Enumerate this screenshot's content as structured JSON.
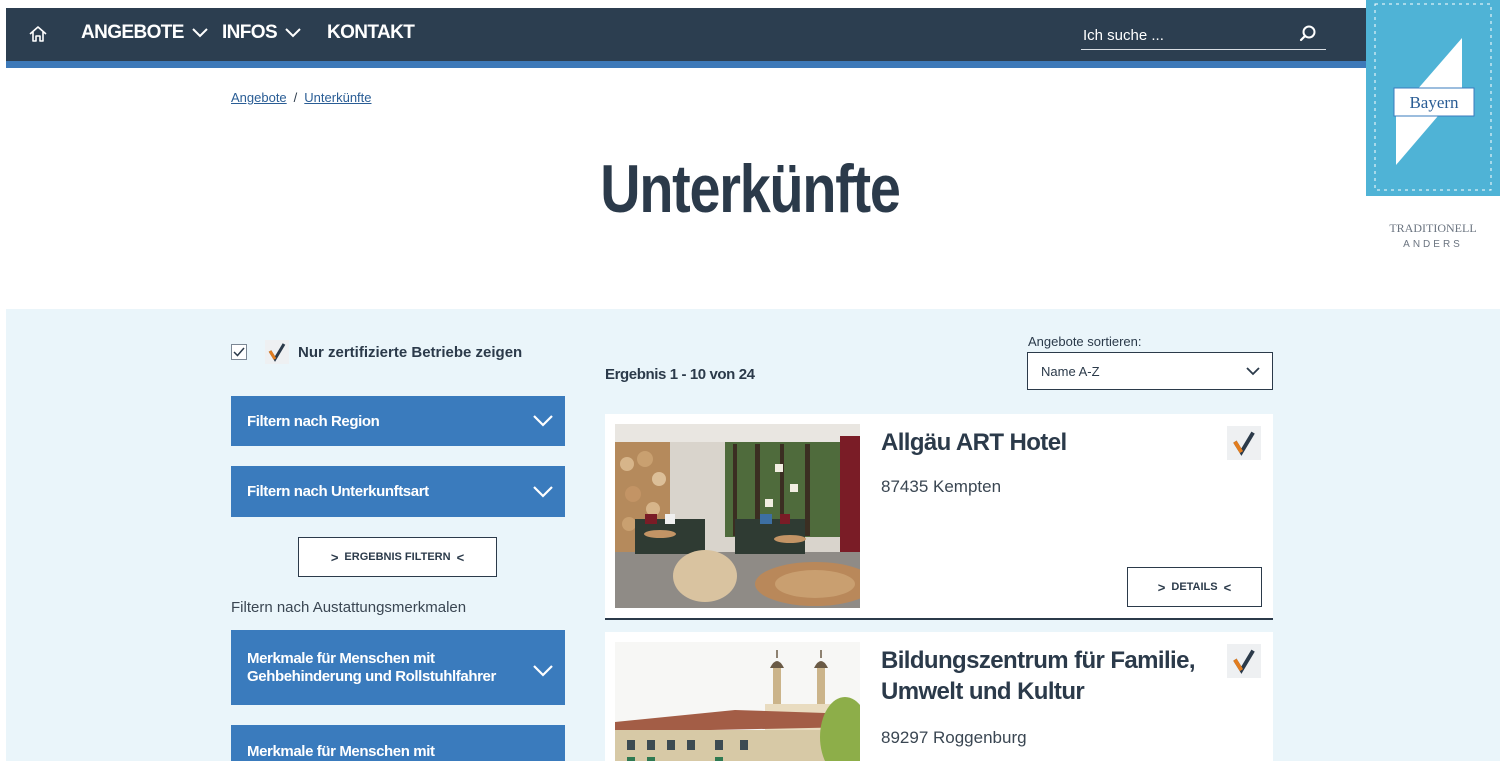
{
  "nav": {
    "items": [
      {
        "label": "ANGEBOTE",
        "dropdown": true
      },
      {
        "label": "INFOS",
        "dropdown": true
      },
      {
        "label": "KONTAKT",
        "dropdown": false
      }
    ],
    "search_placeholder": "Ich suche ..."
  },
  "breadcrumb": {
    "items": [
      "Angebote",
      "Unterkünfte"
    ],
    "separator": "/"
  },
  "page_title": "Unterkünfte",
  "sidebar": {
    "certified_only_label": "Nur zertifizierte Betriebe zeigen",
    "certified_only_checked": true,
    "filters": [
      "Filtern nach Region",
      "Filtern nach Unterkunftsart"
    ],
    "filter_button": "ERGEBNIS FILTERN",
    "features_label": "Filtern nach Austattungsmerkmalen",
    "feature_filters": [
      "Merkmale für Menschen mit Gehbehinderung und Rollstuhlfahrer",
      "Merkmale für Menschen mit"
    ]
  },
  "results": {
    "count_label": "Ergebnis 1 - 10 von 24",
    "sort_label": "Angebote sortieren:",
    "sort_value": "Name A-Z",
    "details_label": "DETAILS",
    "items": [
      {
        "title": "Allgäu ART Hotel",
        "location": "87435 Kempten"
      },
      {
        "title": "Bildungszentrum für Familie, Umwelt und Kultur",
        "location": "89297 Roggenburg"
      }
    ]
  },
  "badge": {
    "brand": "Bayern",
    "tagline_top": "TRADITIONELL",
    "tagline_bottom": "ANDERS"
  },
  "colors": {
    "nav": "#2c3e50",
    "accent": "#3a7bbd",
    "section_bg": "#eaf5fa",
    "text": "#2b3a4a",
    "badge": "#4fb3d6"
  }
}
